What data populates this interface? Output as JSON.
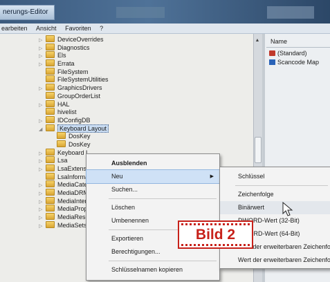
{
  "window": {
    "title": "nerungs-Editor"
  },
  "menubar": [
    "earbeiten",
    "Ansicht",
    "Favoriten",
    "?"
  ],
  "tree": {
    "items": [
      {
        "label": "DeviceOverrides",
        "expander": "▷"
      },
      {
        "label": "Diagnostics",
        "expander": "▷"
      },
      {
        "label": "Els",
        "expander": "▷"
      },
      {
        "label": "Errata",
        "expander": "▷"
      },
      {
        "label": "FileSystem",
        "expander": ""
      },
      {
        "label": "FileSystemUtilities",
        "expander": ""
      },
      {
        "label": "GraphicsDrivers",
        "expander": "▷"
      },
      {
        "label": "GroupOrderList",
        "expander": ""
      },
      {
        "label": "HAL",
        "expander": "▷"
      },
      {
        "label": "hivelist",
        "expander": ""
      },
      {
        "label": "IDConfigDB",
        "expander": "▷"
      },
      {
        "label": "Keyboard Layout",
        "expander": "◢"
      },
      {
        "label": "DosKey",
        "expander": ""
      },
      {
        "label": "DosKey",
        "expander": ""
      },
      {
        "label": "Keyboard L",
        "expander": "▷"
      },
      {
        "label": "Lsa",
        "expander": "▷"
      },
      {
        "label": "LsaExtensio",
        "expander": "▷"
      },
      {
        "label": "LsaInformat",
        "expander": ""
      },
      {
        "label": "MediaCateg",
        "expander": "▷"
      },
      {
        "label": "MediaDRM",
        "expander": "▷"
      },
      {
        "label": "MediaInterf",
        "expander": "▷"
      },
      {
        "label": "MediaPrope",
        "expander": "▷"
      },
      {
        "label": "MediaResou",
        "expander": "▷"
      },
      {
        "label": "MediaSets",
        "expander": "▷"
      }
    ]
  },
  "values": {
    "header": "Name",
    "rows": [
      {
        "label": "(Standard)",
        "icon": "string-value-icon"
      },
      {
        "label": "Scancode Map",
        "icon": "binary-value-icon"
      }
    ]
  },
  "context_menu": {
    "items": [
      {
        "label": "Ausblenden",
        "bold": true
      },
      {
        "label": "Neu",
        "submenu": true,
        "highlighted": true
      },
      {
        "label": "Suchen...",
        "sep_after": true
      },
      {
        "label": "Löschen"
      },
      {
        "label": "Umbenennen",
        "sep_after": true
      },
      {
        "label": "Exportieren"
      },
      {
        "label": "Berechtigungen...",
        "sep_after": true
      },
      {
        "label": "Schlüsselnamen kopieren"
      }
    ]
  },
  "submenu": {
    "items": [
      {
        "label": "Schlüssel",
        "sep_after": true
      },
      {
        "label": "Zeichenfolge"
      },
      {
        "label": "Binärwert",
        "highlighted": true
      },
      {
        "label": "DWORD-Wert (32-Bit)"
      },
      {
        "label": "QWORD-Wert (64-Bit)"
      },
      {
        "label": "Wert der erweiterbaren Zeichenfolge"
      },
      {
        "label": "Wert der erweiterbaren Zeichenfolge"
      }
    ]
  },
  "overlay": {
    "label": "Bild 2"
  },
  "colors": {
    "accent_red": "#c7211a",
    "selection": "#c9dcf2",
    "title_bar": "#3b5a7e"
  }
}
